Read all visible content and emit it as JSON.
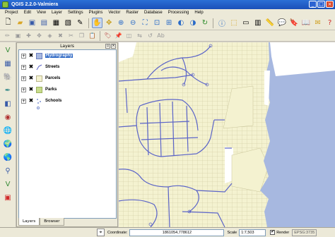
{
  "window": {
    "title": "QGIS 2.2.0-Valmiera"
  },
  "menu": [
    "Project",
    "Edit",
    "View",
    "Layer",
    "Settings",
    "Plugins",
    "Vector",
    "Raster",
    "Database",
    "Processing",
    "Help"
  ],
  "toolbar": {
    "row1_icons": [
      "new-project-icon",
      "open-project-icon",
      "save-project-icon",
      "save-as-icon",
      "print-composer-icon",
      "composer-manager-icon",
      "style-manager-icon",
      "pan-icon",
      "pan-to-selection-icon",
      "zoom-in-icon",
      "zoom-out-icon",
      "zoom-full-icon",
      "zoom-selection-icon",
      "zoom-layer-icon",
      "zoom-last-icon",
      "zoom-next-icon",
      "refresh-icon",
      "identify-icon",
      "select-icon",
      "deselect-icon",
      "open-table-icon",
      "measure-icon",
      "map-tips-icon",
      "new-bookmark-icon",
      "show-bookmarks-icon",
      "text-annotation-icon",
      "help-icon"
    ],
    "row2_icons": [
      "toggle-editing-icon",
      "save-edits-icon",
      "add-feature-icon",
      "move-feature-icon",
      "node-tool-icon",
      "delete-selected-icon",
      "cut-icon",
      "copy-icon",
      "paste-icon",
      "label-icon",
      "pin-label-icon",
      "show-hide-label-icon",
      "move-label-icon",
      "rotate-label-icon",
      "change-label-icon"
    ]
  },
  "left_toolbar": [
    "add-vector-layer-icon",
    "add-raster-layer-icon",
    "add-postgis-icon",
    "add-spatialite-icon",
    "add-mssql-icon",
    "add-oracle-icon",
    "add-wms-icon",
    "add-wcs-icon",
    "add-wfs-icon",
    "add-delimited-text-icon",
    "new-shapefile-icon",
    "remove-layer-icon"
  ],
  "layers_panel": {
    "title": "Layers",
    "layers": [
      {
        "name": "Hydrography",
        "type": "polygon",
        "color": "#a7b8e0",
        "checked": true,
        "selected": true
      },
      {
        "name": "Streets",
        "type": "line",
        "color": "#5b64c8",
        "checked": true,
        "selected": false
      },
      {
        "name": "Parcels",
        "type": "polygon",
        "color": "#f4f2d0",
        "checked": true,
        "selected": false
      },
      {
        "name": "Parks",
        "type": "polygon",
        "color": "#c8dc8c",
        "checked": true,
        "selected": false
      },
      {
        "name": "Schools",
        "type": "point",
        "color": "#7a8fd0",
        "checked": true,
        "selected": false
      }
    ],
    "tabs": [
      "Layers",
      "Browser"
    ]
  },
  "map": {
    "water_color": "#a7b8e0",
    "parcel_color": "#f4f2d0",
    "street_color": "#5b64c8"
  },
  "status": {
    "coordinate_label": "Coordinate:",
    "coordinate_value": "1861054,778612",
    "scale_label": "Scale",
    "scale_value": "1:7,503",
    "render_label": "Render",
    "render_checked": true,
    "crs": "EPSG:3735"
  }
}
